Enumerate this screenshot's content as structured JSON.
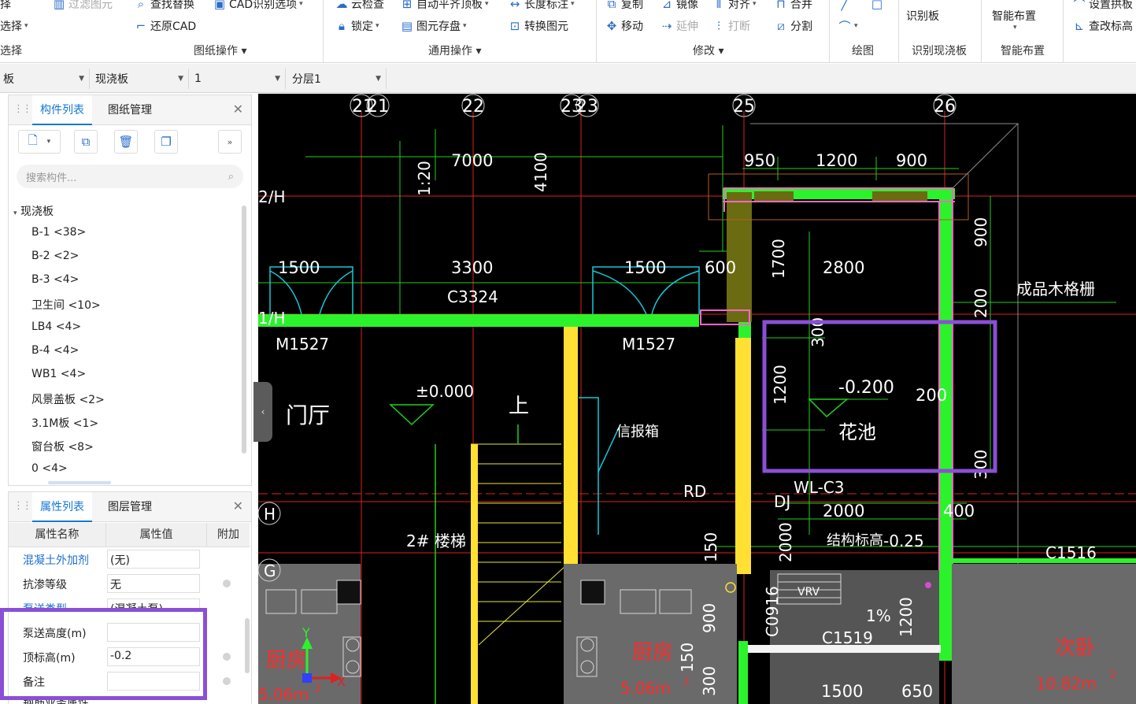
{
  "ribbon": {
    "row1": [
      {
        "id": "select",
        "text": "择",
        "icon": ""
      },
      {
        "id": "filter",
        "text": "过滤图元",
        "icon": "filter-icon",
        "disabled": true
      },
      {
        "id": "find-replace",
        "text": "查找替换",
        "icon": "find-replace-icon"
      },
      {
        "id": "cad-options",
        "text": "CAD识别选项",
        "icon": "cad-options-icon",
        "dropdown": true
      },
      {
        "id": "cloud-check",
        "text": "云检查",
        "icon": "cloud-check-icon"
      },
      {
        "id": "auto-align-slab",
        "text": "自动平齐顶板",
        "icon": "auto-align-icon",
        "dropdown": true
      },
      {
        "id": "length-label",
        "text": "长度标注",
        "icon": "dimension-icon",
        "dropdown": true
      },
      {
        "id": "copy",
        "text": "复制",
        "icon": "copy-icon"
      },
      {
        "id": "mirror",
        "text": "镜像",
        "icon": "mirror-icon"
      },
      {
        "id": "align",
        "text": "对齐",
        "icon": "align-icon",
        "dropdown": true
      },
      {
        "id": "merge",
        "text": "合并",
        "icon": "merge-icon"
      },
      {
        "id": "set-arch",
        "text": "设置拱板",
        "icon": "arch-icon"
      }
    ],
    "row2": [
      {
        "id": "select2",
        "text": "选择",
        "icon": "",
        "dropdown": true
      },
      {
        "id": "restore-cad",
        "text": "还原CAD",
        "icon": "restore-cad-icon"
      },
      {
        "id": "lock",
        "text": "锁定",
        "icon": "lock-icon",
        "dropdown": true
      },
      {
        "id": "element-store",
        "text": "图元存盘",
        "icon": "save-element-icon",
        "dropdown": true
      },
      {
        "id": "convert-element",
        "text": "转换图元",
        "icon": "convert-icon"
      },
      {
        "id": "move",
        "text": "移动",
        "icon": "move-icon"
      },
      {
        "id": "extend",
        "text": "延伸",
        "icon": "extend-icon",
        "disabled": true
      },
      {
        "id": "break",
        "text": "打断",
        "icon": "break-icon",
        "disabled": true
      },
      {
        "id": "split",
        "text": "分割",
        "icon": "split-icon"
      },
      {
        "id": "check-elevation",
        "text": "查改标高",
        "icon": "elevation-icon"
      }
    ],
    "big": [
      {
        "id": "recognize-slab",
        "text": "识别板"
      },
      {
        "id": "smart-layout",
        "text": "智能布置"
      }
    ],
    "groups": [
      {
        "id": "select",
        "text": "选择"
      },
      {
        "id": "drawing-ops",
        "text": "图纸操作"
      },
      {
        "id": "general-ops",
        "text": "通用操作"
      },
      {
        "id": "modify",
        "text": "修改"
      },
      {
        "id": "draw",
        "text": "绘图"
      },
      {
        "id": "recognize-cast-slab",
        "text": "识别现浇板"
      },
      {
        "id": "smart-layout-group",
        "text": "智能布置"
      }
    ]
  },
  "selectors": [
    "板",
    "现浇板",
    "1",
    "分层1"
  ],
  "component_panel": {
    "tabs": [
      "构件列表",
      "图纸管理"
    ],
    "search_placeholder": "搜索构件...",
    "root": "现浇板",
    "items": [
      "B-1 <38>",
      "B-2 <2>",
      "B-3 <4>",
      "卫生间 <10>",
      "LB4 <4>",
      "B-4 <4>",
      "WB1 <4>",
      "风景盖板 <2>",
      "3.1M板 <1>",
      "窗台板 <8>",
      "0 <4>"
    ]
  },
  "property_panel": {
    "tabs": [
      "属性列表",
      "图层管理"
    ],
    "headers": [
      "属性名称",
      "属性值",
      "附加"
    ],
    "rows": [
      {
        "name": "混凝土外加剂",
        "value": "(无)",
        "link": true,
        "dot": false
      },
      {
        "name": "抗渗等级",
        "value": "无",
        "link": false,
        "dot": true
      },
      {
        "name": "泵送类型",
        "value": "(混凝土泵)",
        "link": true,
        "dot": false
      },
      {
        "name": "泵送高度(m)",
        "value": "",
        "link": false,
        "dot": false
      },
      {
        "name": "顶标高(m)",
        "value": "-0.2",
        "link": false,
        "dot": true
      },
      {
        "name": "备注",
        "value": "",
        "link": false,
        "dot": true
      },
      {
        "name": "钢筋业务属性",
        "value": "",
        "link": false,
        "dot": false
      }
    ]
  },
  "cad": {
    "grid_labels": [
      "21",
      "21",
      "22",
      "23",
      "23",
      "25",
      "26"
    ],
    "row_labels": [
      "2/H",
      "1/H",
      "H",
      "G"
    ],
    "dims": [
      "7000",
      "950",
      "1200",
      "900",
      "1500",
      "3300",
      "1500",
      "600",
      "1700",
      "2800",
      "900",
      "200",
      "300",
      "1200",
      "200",
      "300",
      "2000",
      "2000",
      "400",
      "150",
      "900",
      "150",
      "300",
      "1200",
      "1500",
      "650",
      "4100",
      "1:20"
    ],
    "texts": [
      "C3324",
      "M1527",
      "M1527",
      "±0.000",
      "门厅",
      "上",
      "信报箱",
      "-0.200",
      "花池",
      "成品木格栅",
      "RD",
      "DJ",
      "WL-C3",
      "结构标高",
      "-0.25",
      "2# 楼梯",
      "C1516",
      "C0916",
      "VRV",
      "1%",
      "C1519",
      "厨房",
      "5.06m",
      "厨房",
      "5.06m",
      "次卧",
      "10.82m",
      "2",
      "2",
      "2"
    ],
    "axis": [
      "Y",
      "X"
    ]
  },
  "colors": {
    "accent": "#1677d2",
    "highlight": "#8a4fd6"
  }
}
